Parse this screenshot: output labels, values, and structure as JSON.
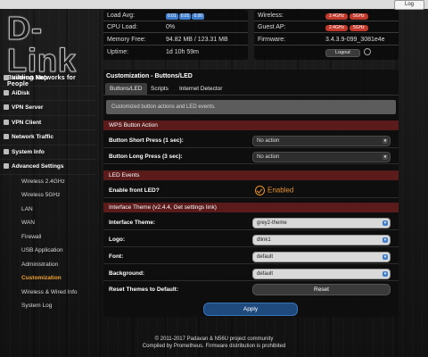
{
  "topbar": {
    "log_label": "Log"
  },
  "logo": {
    "word": "D-Link",
    "tagline": "Building Networks for People"
  },
  "status": {
    "load_avg_label": "Load Avg:",
    "load_avg": [
      "0.01",
      "0.01",
      "0.00"
    ],
    "cpu_label": "CPU Load:",
    "cpu_value": "0%",
    "memory_label": "Memory Free:",
    "memory_value": "94.82 MB / 123.31 MB",
    "uptime_label": "Uptime:",
    "uptime_value": "1d 10h 59m"
  },
  "radio": {
    "wireless_label": "Wireless:",
    "wireless_24": "2.4GHz",
    "wireless_5": "5GHz",
    "guest_label": "Guest AP:",
    "guest_24": "2.4GHz",
    "guest_5": "5GHz",
    "firmware_label": "Firmware:",
    "firmware_value": "3.4.3.9-099_3081e4e",
    "logout_label": "Logout"
  },
  "sidebar": {
    "items": [
      {
        "label": "Network Map",
        "icon": "network-map-icon"
      },
      {
        "label": "AiDisk",
        "icon": "disk-icon"
      },
      {
        "label": "VPN Server",
        "icon": "vpn-server-icon"
      },
      {
        "label": "VPN Client",
        "icon": "vpn-client-icon"
      },
      {
        "label": "Network Traffic",
        "icon": "traffic-icon"
      },
      {
        "label": "System Info",
        "icon": "info-icon"
      },
      {
        "label": "Advanced Settings",
        "icon": "settings-icon"
      }
    ],
    "subitems": [
      "Wireless 2.4GHz",
      "Wireless 5GHz",
      "LAN",
      "WAN",
      "Firewall",
      "USB Application",
      "Administration",
      "Customization",
      "Wireless & Wired Info",
      "System Log"
    ],
    "active_subitem": "Customization"
  },
  "main": {
    "title": "Customization - Buttons/LED",
    "tabs": [
      "Buttons/LED",
      "Scripts",
      "Internet Detector"
    ],
    "active_tab": "Buttons/LED",
    "info": "Customized button actions and LED events.",
    "wps_section": "WPS Button Action",
    "short_press_label": "Button Short Press (1 sec):",
    "short_press_value": "No action",
    "long_press_label": "Button Long Press (3 sec):",
    "long_press_value": "No action",
    "led_section": "LED Events",
    "front_led_label": "Enable front LED?",
    "front_led_value": "Enabled",
    "theme_section": "Interface Theme (v2.4.4, Get settings link)",
    "theme_label": "Interface Theme:",
    "theme_value": "grey2-theme",
    "logo_label": "Logo:",
    "logo_value": "dlink1",
    "font_label": "Font:",
    "font_value": "default",
    "background_label": "Background:",
    "background_value": "default",
    "reset_label": "Reset Themes to Default:",
    "reset_button": "Reset",
    "apply_button": "Apply"
  },
  "footer": {
    "line1": "© 2011-2017 Padavan & N56U project community",
    "line2": "Compiled by Prometheus. Firmware distribution is prohibited"
  },
  "colors": {
    "accent": "#3f7ccc",
    "section": "#5c1b1b",
    "active": "#f0a030",
    "enabled": "#e8932d"
  }
}
